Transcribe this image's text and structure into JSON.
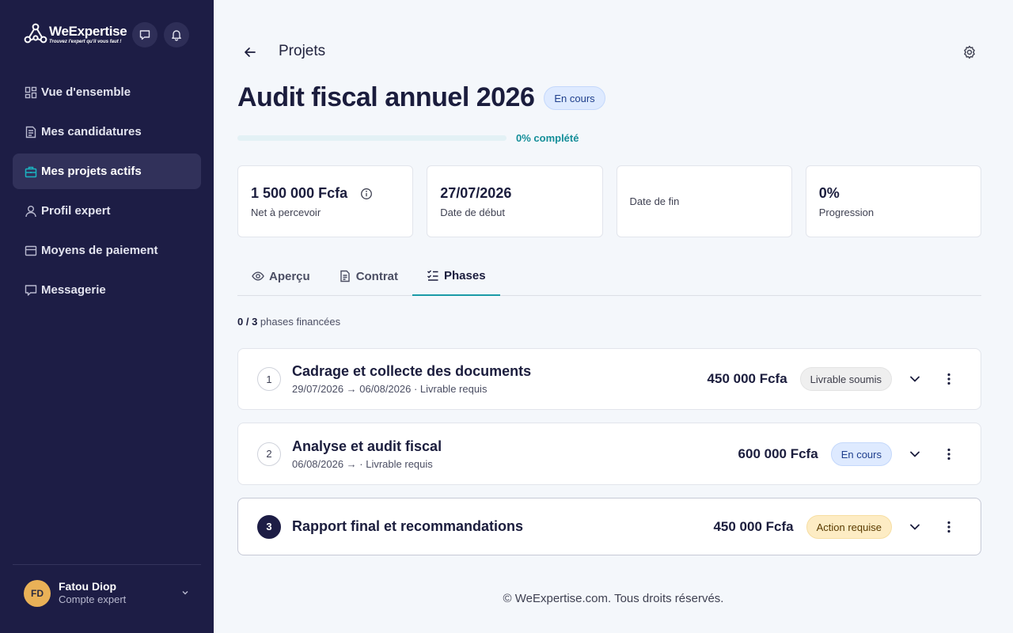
{
  "colors": {
    "sidebar_bg": "#1d1d45",
    "accent_teal": "#1a9aa7",
    "page_bg": "#f4f7fb"
  },
  "brand": {
    "name": "WeExpertise",
    "tagline": "Trouvez l'expert qu'il vous faut !"
  },
  "sidebar": {
    "items": [
      {
        "label": "Vue d'ensemble",
        "icon": "dashboard-icon"
      },
      {
        "label": "Mes candidatures",
        "icon": "document-list-icon"
      },
      {
        "label": "Mes projets actifs",
        "icon": "briefcase-icon",
        "active": true
      },
      {
        "label": "Profil expert",
        "icon": "user-icon"
      },
      {
        "label": "Moyens de paiement",
        "icon": "credit-card-icon"
      },
      {
        "label": "Messagerie",
        "icon": "message-icon"
      }
    ]
  },
  "user": {
    "initials": "FD",
    "name": "Fatou Diop",
    "role": "Compte expert"
  },
  "header": {
    "breadcrumb": "Projets"
  },
  "project": {
    "title": "Audit fiscal annuel 2026",
    "status": "En cours",
    "progress": 0,
    "progress_label": "0% complété"
  },
  "stats": [
    {
      "value": "1 500 000 Fcfa",
      "label": "Net à percevoir"
    },
    {
      "value": "27/07/2026",
      "label": "Date de début"
    },
    {
      "value": "",
      "label": "Date de fin"
    },
    {
      "value": "0%",
      "label": "Progression"
    }
  ],
  "tabs": [
    {
      "label": "Aperçu",
      "icon": "eye-icon"
    },
    {
      "label": "Contrat",
      "icon": "document-icon"
    },
    {
      "label": "Phases",
      "icon": "checklist-icon",
      "active": true
    }
  ],
  "funded": {
    "count": "0 / 3",
    "text": "phases financées"
  },
  "phases": [
    {
      "number": "1",
      "title": "Cadrage et collecte des documents",
      "subtitle": "29/07/2026 → 06/08/2026 · Livrable requis",
      "amount": "450 000 Fcfa",
      "status": "Livrable soumis"
    },
    {
      "number": "2",
      "title": "Analyse et audit fiscal",
      "subtitle": "06/08/2026 → · Livrable requis",
      "amount": "600 000 Fcfa",
      "status": "En cours"
    },
    {
      "number": "3",
      "title": "Rapport final et recommandations",
      "subtitle": "",
      "amount": "450 000 Fcfa",
      "status": "Action requise"
    }
  ],
  "footer": {
    "text": "© WeExpertise.com. Tous droits réservés."
  }
}
